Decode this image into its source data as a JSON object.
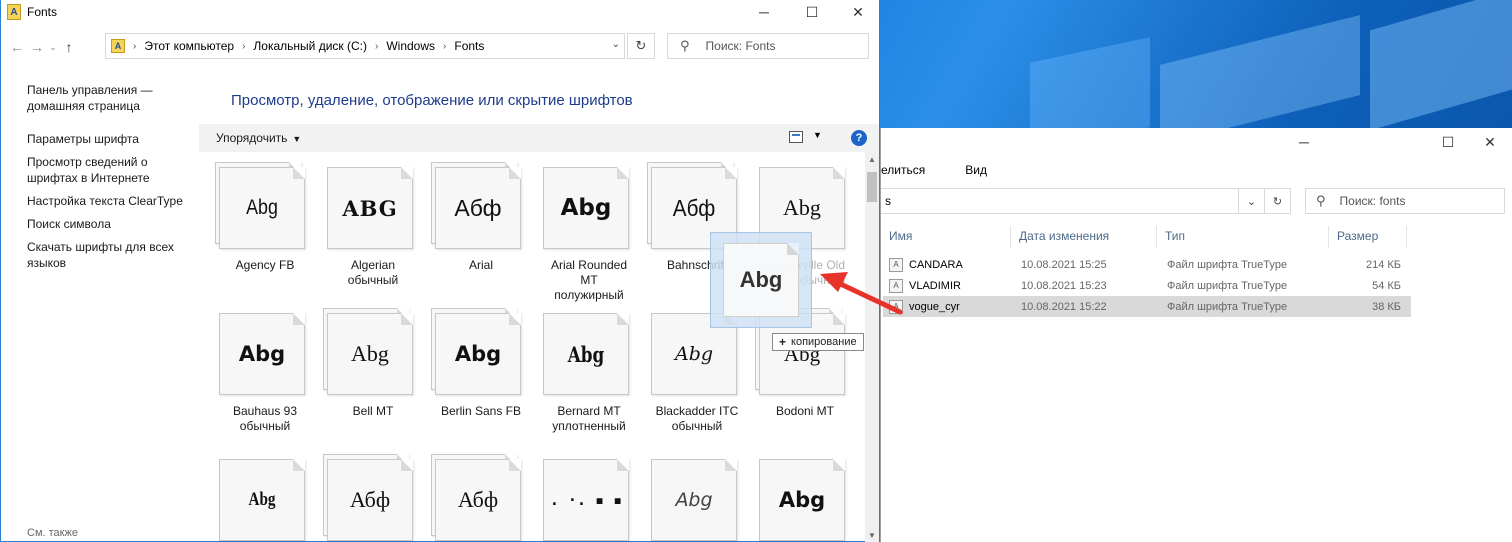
{
  "window1": {
    "title": "Fonts",
    "breadcrumb": [
      "Этот компьютер",
      "Локальный диск (C:)",
      "Windows",
      "Fonts"
    ],
    "search_placeholder": "Поиск: Fonts",
    "heading": "Просмотр, удаление, отображение или скрытие шрифтов",
    "organize_label": "Упорядочить",
    "help_label": "?",
    "left_nav": [
      "Панель управления —\nдомашняя страница",
      "Параметры шрифта",
      "Просмотр сведений о\nшрифтах в Интернете",
      "Настройка текста ClearType",
      "Поиск символа",
      "Скачать шрифты для всех\nязыков"
    ],
    "see_also": "См. также",
    "fonts": [
      {
        "name": "Agency FB",
        "sample": "Abg",
        "stacked": true
      },
      {
        "name": "Algerian\nобычный",
        "sample": "ABG",
        "stacked": false
      },
      {
        "name": "Arial",
        "sample": "Абф",
        "stacked": true
      },
      {
        "name": "Arial Rounded\nMT\nполужирный",
        "sample": "Abg",
        "stacked": false
      },
      {
        "name": "Bahnschrift",
        "sample": "Абф",
        "stacked": true
      },
      {
        "name": "Baskerville Old\nFace обычный",
        "sample": "Abg",
        "stacked": false
      },
      {
        "name": "Bauhaus 93\nобычный",
        "sample": "Abg",
        "stacked": false
      },
      {
        "name": "Bell MT",
        "sample": "Abg",
        "stacked": true
      },
      {
        "name": "Berlin Sans FB",
        "sample": "Abg",
        "stacked": true
      },
      {
        "name": "Bernard MT\nуплотненный",
        "sample": "Abg",
        "stacked": false
      },
      {
        "name": "Blackadder ITC\nобычный",
        "sample": "Abg",
        "stacked": false
      },
      {
        "name": "Bodoni MT",
        "sample": "Abg",
        "stacked": true
      },
      {
        "name": "",
        "sample": "Abg",
        "stacked": false
      },
      {
        "name": "",
        "sample": "Абф",
        "stacked": true
      },
      {
        "name": "",
        "sample": "Абф",
        "stacked": true
      },
      {
        "name": "",
        "sample": ". ·. ▪ ▪",
        "stacked": false
      },
      {
        "name": "",
        "sample": "Abg",
        "stacked": false
      },
      {
        "name": "",
        "sample": "Abg",
        "stacked": false
      }
    ]
  },
  "drag": {
    "ghost_sample": "Abg",
    "tooltip": "копирование",
    "tooltip_prefix": "+"
  },
  "window2": {
    "ribbon": [
      "елиться",
      "Вид"
    ],
    "address_text": "s",
    "search_placeholder": "Поиск: fonts",
    "columns": [
      "Имя",
      "Дата изменения",
      "Тип",
      "Размер"
    ],
    "files": [
      {
        "name": "CANDARA",
        "date": "10.08.2021 15:25",
        "type": "Файл шрифта TrueType",
        "size": "214 КБ",
        "selected": false
      },
      {
        "name": "VLADIMIR",
        "date": "10.08.2021 15:23",
        "type": "Файл шрифта TrueType",
        "size": "54 КБ",
        "selected": false
      },
      {
        "name": "vogue_cyr",
        "date": "10.08.2021 15:22",
        "type": "Файл шрифта TrueType",
        "size": "38 КБ",
        "selected": true
      }
    ]
  },
  "colors": {
    "accent": "#1e3c8c",
    "arrow": "#e8332a",
    "selection": "#d9d9d9"
  }
}
